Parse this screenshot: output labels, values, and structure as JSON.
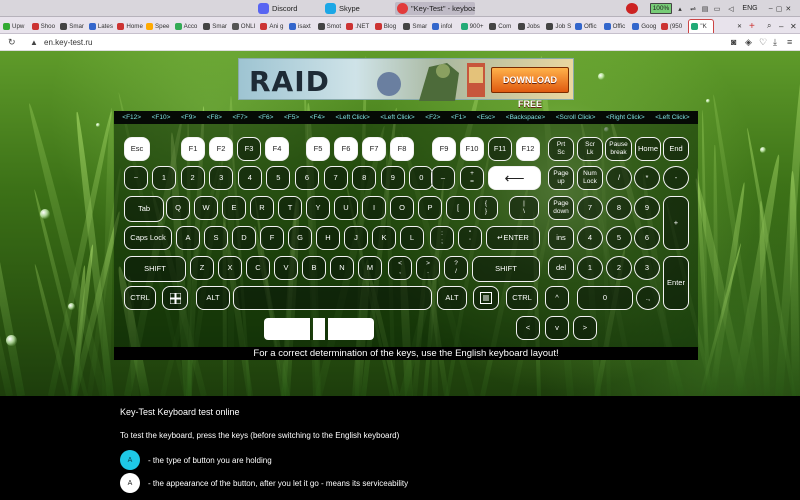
{
  "taskbar": {
    "apps": [
      {
        "label": "Discord",
        "color": "#5865f2"
      },
      {
        "label": "Skype",
        "color": "#1ba7e6"
      },
      {
        "label": "\"Key-Test\" - keyboa...",
        "color": "#e23b3b"
      }
    ],
    "battery": "100%",
    "lang": "ENG"
  },
  "tabs": [
    {
      "label": "Upw",
      "color": "#3a3"
    },
    {
      "label": "Shoo",
      "color": "#c33"
    },
    {
      "label": "Smar",
      "color": "#444"
    },
    {
      "label": "Lates",
      "color": "#36c"
    },
    {
      "label": "Home",
      "color": "#c33"
    },
    {
      "label": "Spee",
      "color": "#fa0"
    },
    {
      "label": "Acco",
      "color": "#3a5"
    },
    {
      "label": "Smar",
      "color": "#444"
    },
    {
      "label": "ONLI",
      "color": "#555"
    },
    {
      "label": "Ani g",
      "color": "#c33"
    },
    {
      "label": "isaxt",
      "color": "#36c"
    },
    {
      "label": "Smot",
      "color": "#444"
    },
    {
      "label": ".NET",
      "color": "#c33"
    },
    {
      "label": "Blog",
      "color": "#c33"
    },
    {
      "label": "Smar",
      "color": "#444"
    },
    {
      "label": "infol",
      "color": "#36c"
    },
    {
      "label": "900+",
      "color": "#2a7"
    },
    {
      "label": "Com",
      "color": "#444"
    },
    {
      "label": "Jobs",
      "color": "#444"
    },
    {
      "label": "Job S",
      "color": "#444"
    },
    {
      "label": "Offic",
      "color": "#36c"
    },
    {
      "label": "Offic",
      "color": "#36c"
    },
    {
      "label": "Goog",
      "color": "#36c"
    },
    {
      "label": "(950",
      "color": "#c33"
    },
    {
      "label": "\"K",
      "color": "#2a7"
    }
  ],
  "address": {
    "url": "en.key-test.ru"
  },
  "ad": {
    "logo": "RAID",
    "button": "DOWNLOAD FREE"
  },
  "shortcuts": [
    "<F12>",
    "<F10>",
    "<F9>",
    "<F8>",
    "<F7>",
    "<F6>",
    "<F5>",
    "<F4>",
    "<Left Click>",
    "<Left Click>",
    "<F2>",
    "<F1>",
    "<Esc>",
    "<Backspace>",
    "<Scroll Click>",
    "<Right Click>",
    "<Left Click>"
  ],
  "keys": {
    "esc": "Esc",
    "f1": "F1",
    "f2": "F2",
    "f3": "F3",
    "f4": "F4",
    "f5": "F5",
    "f6": "F6",
    "f7": "F7",
    "f8": "F8",
    "f9": "F9",
    "f10": "F10",
    "f11": "F11",
    "f12": "F12",
    "prtsc_1": "Prt",
    "prtsc_2": "Sc",
    "scrlk_1": "Scr",
    "scrlk_2": "Lk",
    "pause_1": "Pause",
    "pause_2": "break",
    "home": "Home",
    "end": "End",
    "tilde": "~",
    "n1": "1",
    "n2": "2",
    "n3": "3",
    "n4": "4",
    "n5": "5",
    "n6": "6",
    "n7": "7",
    "n8": "8",
    "n9": "9",
    "n0": "0",
    "minus": "–",
    "equal_1": "+",
    "equal_2": "=",
    "backspace": "⟵",
    "pgup_1": "Page",
    "pgup_2": "up",
    "numlk_1": "Num",
    "numlk_2": "Lock",
    "slash": "/",
    "star": "*",
    "npminus": "-",
    "tab": "Tab",
    "q": "Q",
    "w": "W",
    "e": "E",
    "r": "R",
    "t": "T",
    "y": "Y",
    "u": "U",
    "i": "I",
    "o": "O",
    "p": "P",
    "lbr": "[",
    "rbr_1": "{",
    "rbr_2": "}",
    "bslash_1": "|",
    "bslash_2": "\\",
    "pgdn_1": "Page",
    "pgdn_2": "down",
    "np7": "7",
    "np8": "8",
    "np9": "9",
    "npplus": "+",
    "caps": "Caps Lock",
    "a": "A",
    "s": "S",
    "d": "D",
    "f": "F",
    "g": "G",
    "h": "H",
    "j": "J",
    "k": "K",
    "l": "L",
    "semi_1": ":",
    "semi_2": ";",
    "quote_1": "\"",
    "quote_2": "'",
    "enter": "↵ENTER",
    "ins": "ins",
    "np4": "4",
    "np5": "5",
    "np6": "6",
    "shift": "SHIFT",
    "z": "Z",
    "x": "X",
    "c": "C",
    "v": "V",
    "b": "B",
    "n": "N",
    "m": "M",
    "comma_1": "<",
    "comma_2": ",",
    "period_1": ">",
    "period_2": ".",
    "qmark_1": "?",
    "qmark_2": "/",
    "rshift": "SHIFT",
    "del": "del",
    "np1": "1",
    "np2": "2",
    "np3": "3",
    "npenter": "Enter",
    "ctrl": "CTRL",
    "alt": "ALT",
    "altgr": "ALT",
    "rctrl": "CTRL",
    "up": "^",
    "np0": "0",
    "npdot": ".,",
    "left": "<",
    "down": "v",
    "right": ">"
  },
  "note": "For a correct determination of the keys, use the English keyboard layout!",
  "info": {
    "heading": "Key-Test Keyboard test online",
    "instruction": "To test the keyboard, press the keys (before switching to the English keyboard)",
    "legend": [
      {
        "key": "A",
        "text": "- the type of button you are holding",
        "color": "#1ec8e6"
      },
      {
        "key": "A",
        "text": "- the appearance of the button, after you let it go - means its serviceability",
        "color": "#ffffff"
      }
    ]
  }
}
